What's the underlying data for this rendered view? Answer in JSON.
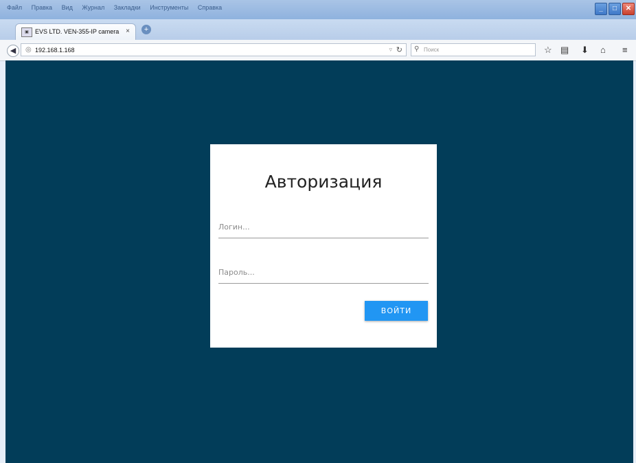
{
  "menu": [
    "Файл",
    "Правка",
    "Вид",
    "Журнал",
    "Закладки",
    "Инструменты",
    "Справка"
  ],
  "tab": {
    "title": "EVS LTD. VEN-355-IP camera",
    "close": "×",
    "new_tab": "+"
  },
  "nav": {
    "url": "192.168.1.168",
    "search_placeholder": "Поиск"
  },
  "login": {
    "title": "Авторизация",
    "login_placeholder": "Логин...",
    "password_placeholder": "Пароль...",
    "button": "ВОЙТИ"
  },
  "colors": {
    "page_bg": "#023d59",
    "card_bg": "#ffffff",
    "button_bg": "#2196f3"
  }
}
